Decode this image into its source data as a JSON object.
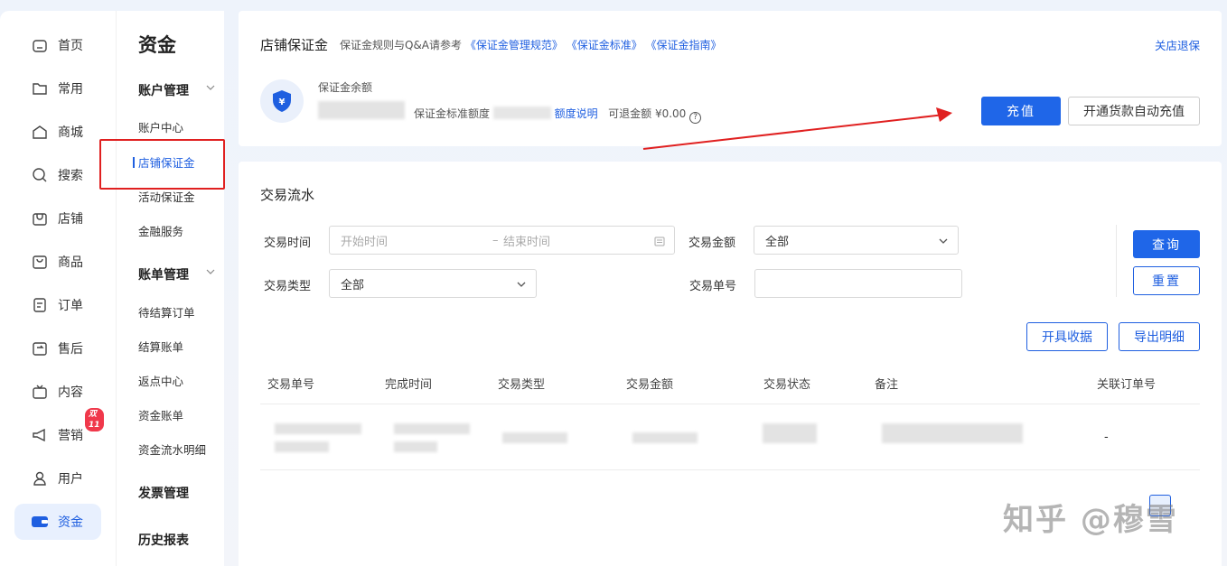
{
  "nav": [
    {
      "label": "首页",
      "icon": "home-icon"
    },
    {
      "label": "常用",
      "icon": "folder-icon"
    },
    {
      "label": "商城",
      "icon": "shop-icon"
    },
    {
      "label": "搜索",
      "icon": "search-icon"
    },
    {
      "label": "店铺",
      "icon": "store-icon"
    },
    {
      "label": "商品",
      "icon": "product-icon"
    },
    {
      "label": "订单",
      "icon": "order-icon"
    },
    {
      "label": "售后",
      "icon": "after-sale-icon"
    },
    {
      "label": "内容",
      "icon": "tv-icon"
    },
    {
      "label": "营销",
      "icon": "megaphone-icon",
      "badge": "双11"
    },
    {
      "label": "用户",
      "icon": "user-icon"
    },
    {
      "label": "资金",
      "icon": "wallet-icon",
      "active": true
    }
  ],
  "subnav": {
    "title": "资金",
    "groups": [
      {
        "label": "账户管理",
        "items": [
          "账户中心",
          "店铺保证金",
          "活动保证金",
          "金融服务"
        ]
      },
      {
        "label": "账单管理",
        "items": [
          "待结算订单",
          "结算账单",
          "返点中心",
          "资金账单",
          "资金流水明细"
        ]
      },
      {
        "label": "发票管理",
        "items": []
      },
      {
        "label": "历史报表",
        "items": []
      }
    ],
    "active_item": "店铺保证金"
  },
  "deposit": {
    "title": "店铺保证金",
    "rules_prefix": "保证金规则与Q&A请参考",
    "links": [
      "《保证金管理规范》",
      "《保证金标准》",
      "《保证金指南》"
    ],
    "close_link": "关店退保",
    "balance_label": "保证金余额",
    "standard_label": "保证金标准额度",
    "quota_link": "额度说明",
    "refundable": "可退金额 ¥0.00",
    "qmark": "?",
    "recharge_btn": "充值",
    "auto_btn": "开通货款自动充值"
  },
  "transactions": {
    "title": "交易流水",
    "time_label": "交易时间",
    "start_ph": "开始时间",
    "end_ph": "结束时间",
    "range_sep": "–",
    "amount_label": "交易金额",
    "amount_value": "全部",
    "type_label": "交易类型",
    "type_value": "全部",
    "no_label": "交易单号",
    "query_btn": "查询",
    "reset_btn": "重置",
    "receipt_btn": "开具收据",
    "export_btn": "导出明细",
    "columns": [
      "交易单号",
      "完成时间",
      "交易类型",
      "交易金额",
      "交易状态",
      "备注",
      "关联订单号"
    ],
    "row_related": "-"
  },
  "watermark": "知乎 @穆雪",
  "colors": {
    "accent": "#1f66e8",
    "highlight": "#e02020"
  }
}
